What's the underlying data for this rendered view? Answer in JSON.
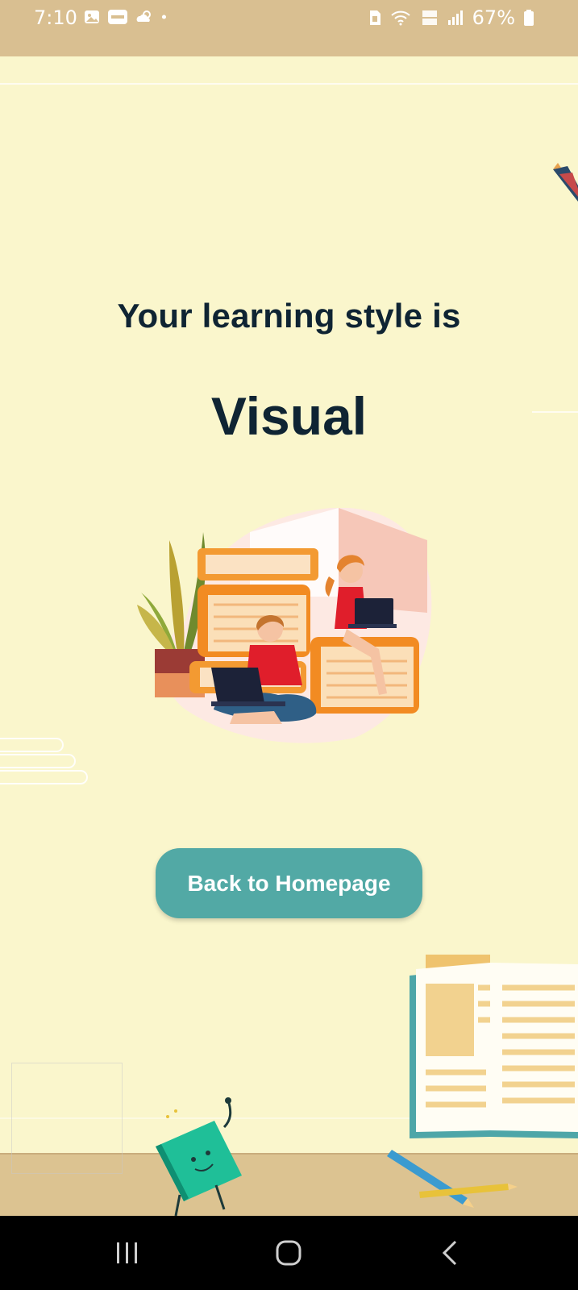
{
  "status_bar": {
    "time": "7:10",
    "battery_percent": "67%",
    "left_icons": [
      "image-icon",
      "paytm-icon",
      "weather-icon",
      "dot-icon"
    ],
    "right_icons": [
      "sim-icon",
      "wifi-icon",
      "volte-icon",
      "signal-icon",
      "battery-icon"
    ]
  },
  "result": {
    "heading": "Your learning style is",
    "style": "Visual"
  },
  "actions": {
    "home_label": "Back to Homepage"
  },
  "illustration": {
    "icon": "students-studying-illustration"
  },
  "nav": {
    "recents": "recents-icon",
    "home": "home-icon",
    "back": "back-icon"
  },
  "colors": {
    "background": "#faf6cc",
    "status_bar": "#d9bf91",
    "heading_text": "#0f2433",
    "button": "#52a9a5",
    "button_text": "#ffffff",
    "floor": "#dcc391"
  }
}
